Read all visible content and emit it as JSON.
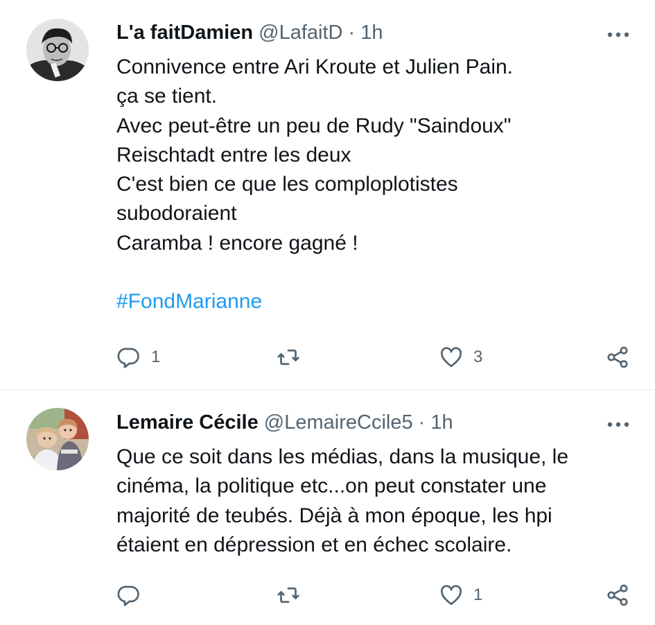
{
  "tweets": [
    {
      "author_name": "L'a faitDamien",
      "handle": "@LafaitD",
      "separator": "·",
      "time": "1h",
      "lines": [
        "Connivence entre Ari Kroute et Julien Pain.",
        "ça se tient.",
        "Avec peut-être un peu de Rudy \"Saindoux\"",
        "Reischtadt entre les deux",
        "C'est bien ce que les comploplotistes",
        "subodoraient",
        "Caramba ! encore gagné !"
      ],
      "hashtag": "#FondMarianne",
      "reply_count": "1",
      "retweet_count": "",
      "like_count": "3"
    },
    {
      "author_name": "Lemaire Cécile",
      "handle": "@LemaireCcile5",
      "separator": "·",
      "time": "1h",
      "lines": [
        "Que ce soit dans les médias, dans la musique, le",
        "cinéma, la politique etc...on peut constater une",
        "majorité de teubés. Déjà à mon époque, les hpi",
        "étaient en dépression et en échec scolaire."
      ],
      "reply_count": "",
      "retweet_count": "",
      "like_count": "1"
    }
  ],
  "icons": {
    "reply": "reply-icon",
    "retweet": "retweet-icon",
    "like": "heart-icon",
    "share": "share-icon",
    "more": "more-icon"
  },
  "colors": {
    "text": "#0f1419",
    "secondary": "#536471",
    "link": "#1d9bf0",
    "divider": "#e6ecf0"
  }
}
